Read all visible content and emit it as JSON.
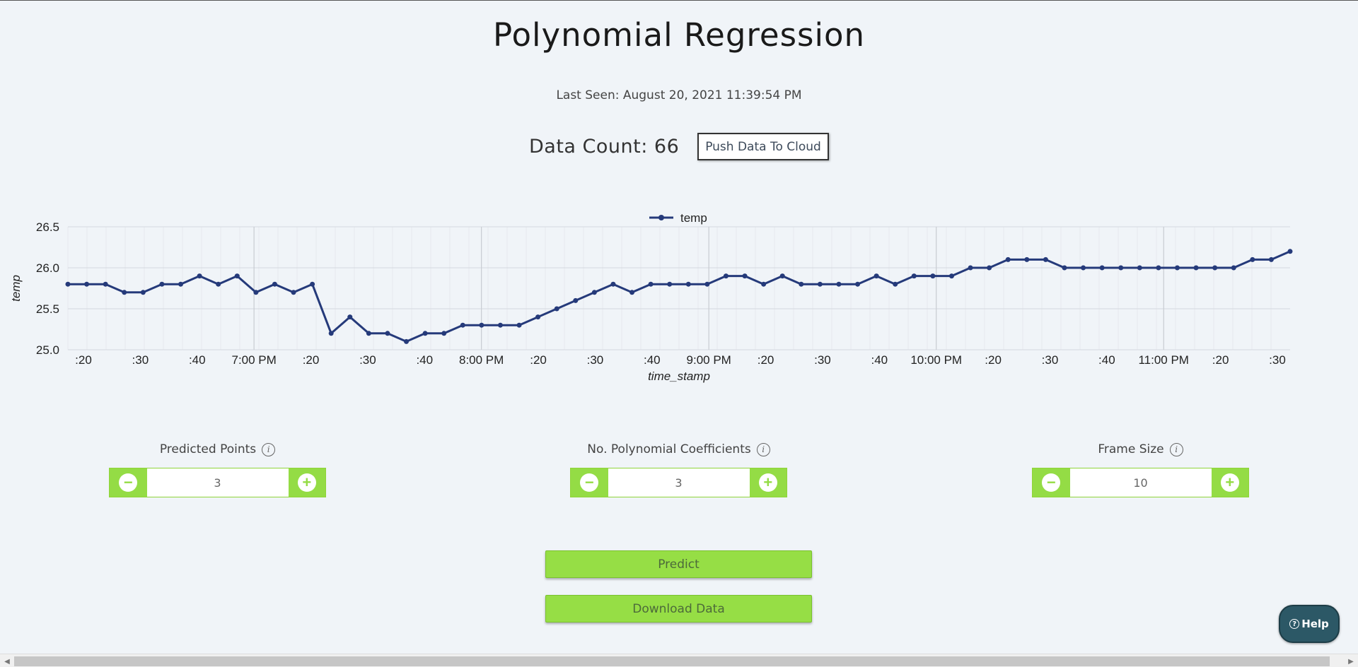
{
  "header": {
    "title": "Polynomial Regression",
    "last_seen": "Last Seen: August 20, 2021 11:39:54 PM",
    "data_count": "Data Count: 66",
    "push_label": "Push Data To Cloud"
  },
  "chart_data": {
    "type": "line",
    "series": [
      {
        "name": "temp",
        "color": "#253a7a",
        "values": [
          25.8,
          25.8,
          25.8,
          25.7,
          25.7,
          25.8,
          25.8,
          25.9,
          25.8,
          25.9,
          25.7,
          25.8,
          25.7,
          25.8,
          25.2,
          25.4,
          25.2,
          25.2,
          25.1,
          25.2,
          25.2,
          25.3,
          25.3,
          25.3,
          25.3,
          25.4,
          25.5,
          25.6,
          25.7,
          25.8,
          25.7,
          25.8,
          25.8,
          25.8,
          25.8,
          25.9,
          25.9,
          25.8,
          25.9,
          25.8,
          25.8,
          25.8,
          25.8,
          25.9,
          25.8,
          25.9,
          25.9,
          25.9,
          26.0,
          26.0,
          26.1,
          26.1,
          26.1,
          26.0,
          26.0,
          26.0,
          26.0,
          26.0,
          26.0,
          26.0,
          26.0,
          26.0,
          26.0,
          26.1,
          26.1,
          26.2
        ]
      }
    ],
    "xlabel": "time_stamp",
    "ylabel": "temp",
    "ylim": [
      25.0,
      26.5
    ],
    "yticks": [
      "25.0",
      "25.5",
      "26.0",
      "26.5"
    ],
    "xticks": [
      ":20",
      ":30",
      ":40",
      "7:00 PM",
      ":20",
      ":30",
      ":40",
      "8:00 PM",
      ":20",
      ":30",
      ":40",
      "9:00 PM",
      ":20",
      ":30",
      ":40",
      "10:00 PM",
      ":20",
      ":30",
      ":40",
      "11:00 PM",
      ":20",
      ":30"
    ],
    "legend": "top-center",
    "grid": true
  },
  "controls": [
    {
      "label": "Predicted Points",
      "value": "3"
    },
    {
      "label": "No. Polynomial Coefficients",
      "value": "3"
    },
    {
      "label": "Frame Size",
      "value": "10"
    }
  ],
  "actions": {
    "predict": "Predict",
    "download": "Download Data",
    "help": "Help"
  },
  "colors": {
    "accent_green": "#94dc45",
    "help_bg": "#2c5866",
    "series": "#253a7a"
  }
}
